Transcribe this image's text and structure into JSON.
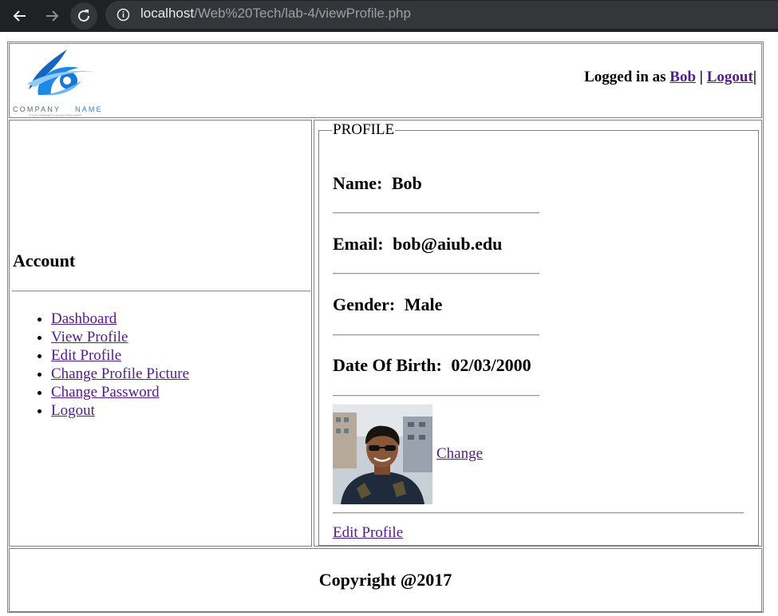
{
  "browser": {
    "url_host": "localhost",
    "url_path": "/Web%20Tech/lab-4/viewProfile.php"
  },
  "header": {
    "logo_company": "COMPANY",
    "logo_name": "NAME",
    "logo_tagline": "YOUR COMPANY SLOGAN GOES HERE",
    "logged_in_prefix": "Logged in as",
    "username": "Bob",
    "separator": "|",
    "logout_label": "Logout",
    "trailing_bar": "|"
  },
  "sidebar": {
    "title": "Account",
    "items": [
      {
        "label": "Dashboard"
      },
      {
        "label": "View Profile"
      },
      {
        "label": "Edit Profile"
      },
      {
        "label": "Change Profile Picture"
      },
      {
        "label": "Change Password"
      },
      {
        "label": "Logout"
      }
    ]
  },
  "profile": {
    "legend": "PROFILE",
    "name_label": "Name:",
    "name_value": "Bob",
    "email_label": "Email:",
    "email_value": "bob@aiub.edu",
    "gender_label": "Gender:",
    "gender_value": "Male",
    "dob_label": "Date Of Birth:",
    "dob_value": "02/03/2000",
    "change_label": "Change",
    "edit_label": "Edit Profile"
  },
  "footer": {
    "copyright": "Copyright @2017"
  },
  "colors": {
    "link": "#551a8b",
    "chrome_bg": "#202124",
    "logo_blue": "#1e88e5"
  }
}
